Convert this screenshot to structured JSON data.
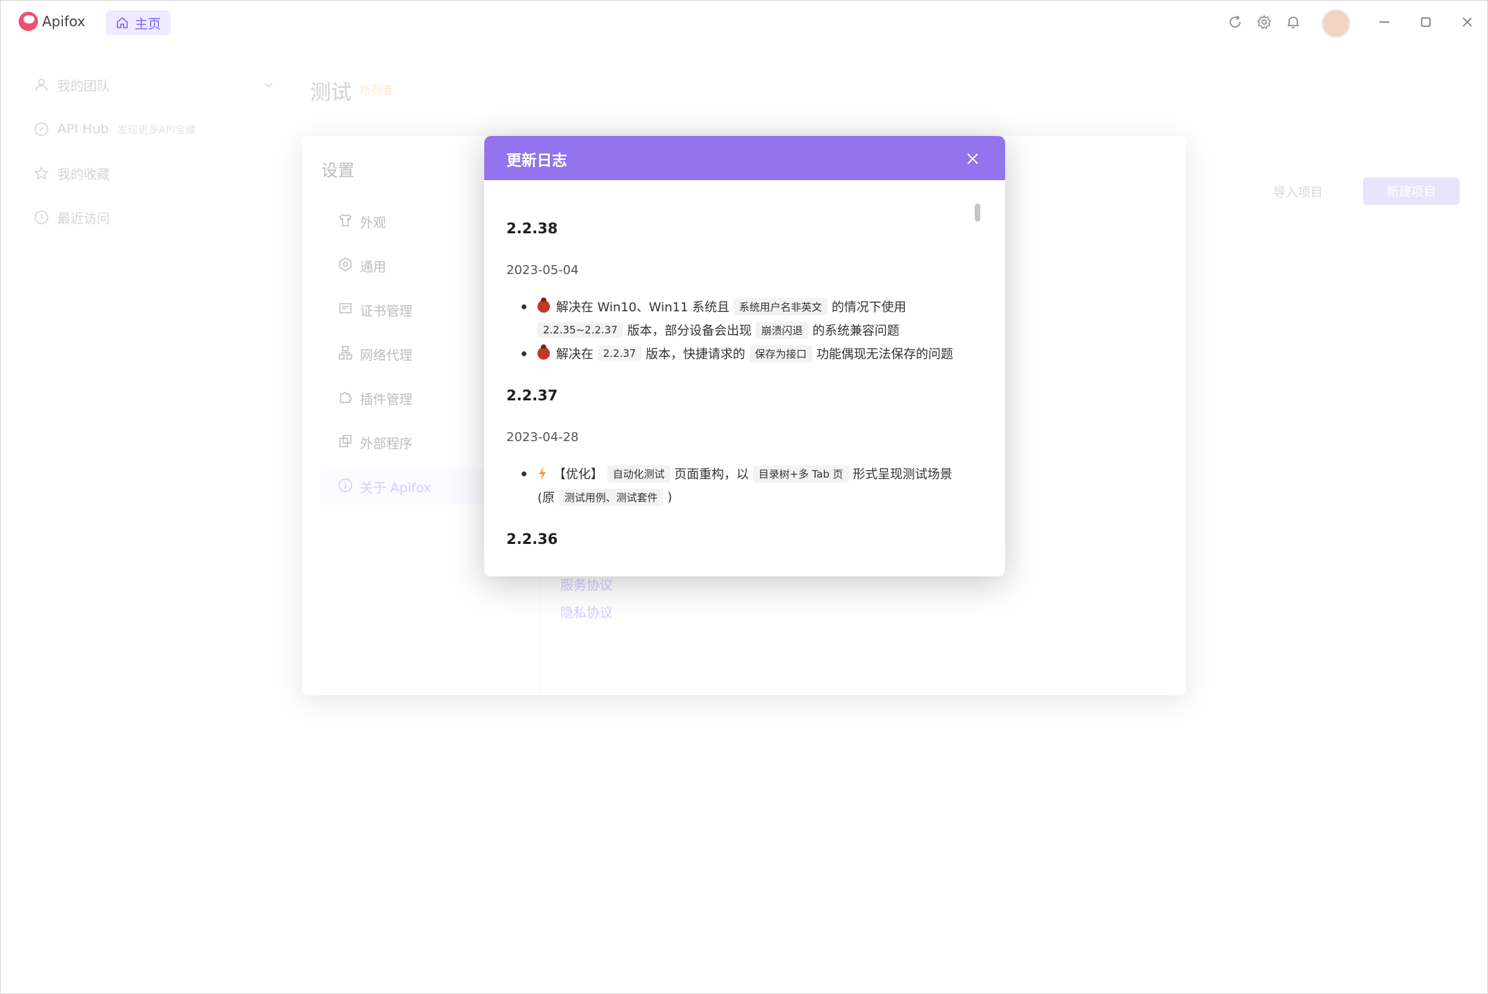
{
  "app": {
    "name": "Apifox",
    "home_tab": "主页"
  },
  "sidebar": {
    "items": [
      {
        "label": "我的团队"
      },
      {
        "label": "API Hub",
        "sub": "发现更多API宝藏"
      },
      {
        "label": "我的收藏"
      },
      {
        "label": "最近访问"
      }
    ]
  },
  "main": {
    "title": "测试",
    "badge": "所有者",
    "import_label": "导入项目",
    "new_label": "新建项目"
  },
  "settings": {
    "title": "设置",
    "menu": [
      {
        "label": "外观"
      },
      {
        "label": "通用"
      },
      {
        "label": "证书管理"
      },
      {
        "label": "网络代理"
      },
      {
        "label": "插件管理"
      },
      {
        "label": "外部程序"
      },
      {
        "label": "关于 Apifox"
      }
    ],
    "links": [
      {
        "label": "服务协议"
      },
      {
        "label": "隐私协议"
      }
    ]
  },
  "changelog": {
    "title": "更新日志",
    "releases": [
      {
        "version": "2.2.38",
        "date": "2023-05-04",
        "lines": {
          "l1a": "解决在 Win10、Win11 系统且",
          "l1code": "系统用户名非英文",
          "l1b": "的情况下使用",
          "l2code1": "2.2.35~2.2.37",
          "l2a": "版本，部分设备会出现",
          "l2code2": "崩溃闪退",
          "l2b": "的系统兼容问题",
          "l3a": "解决在",
          "l3code1": "2.2.37",
          "l3b": "版本，快捷请求的",
          "l3code2": "保存为接口",
          "l3c": "功能偶现无法保存的问题"
        }
      },
      {
        "version": "2.2.37",
        "date": "2023-04-28",
        "lines": {
          "l1a": "【优化】",
          "l1code1": "自动化测试",
          "l1b": "页面重构，以",
          "l1code2": "目录树+多 Tab 页",
          "l1c": "形式呈现测试场景",
          "l2a": "(原",
          "l2code": "测试用例、测试套件",
          "l2b": ")"
        }
      },
      {
        "version": "2.2.36"
      }
    ]
  },
  "icons": {
    "bug": "bug-icon",
    "bolt": "lightning-icon"
  }
}
